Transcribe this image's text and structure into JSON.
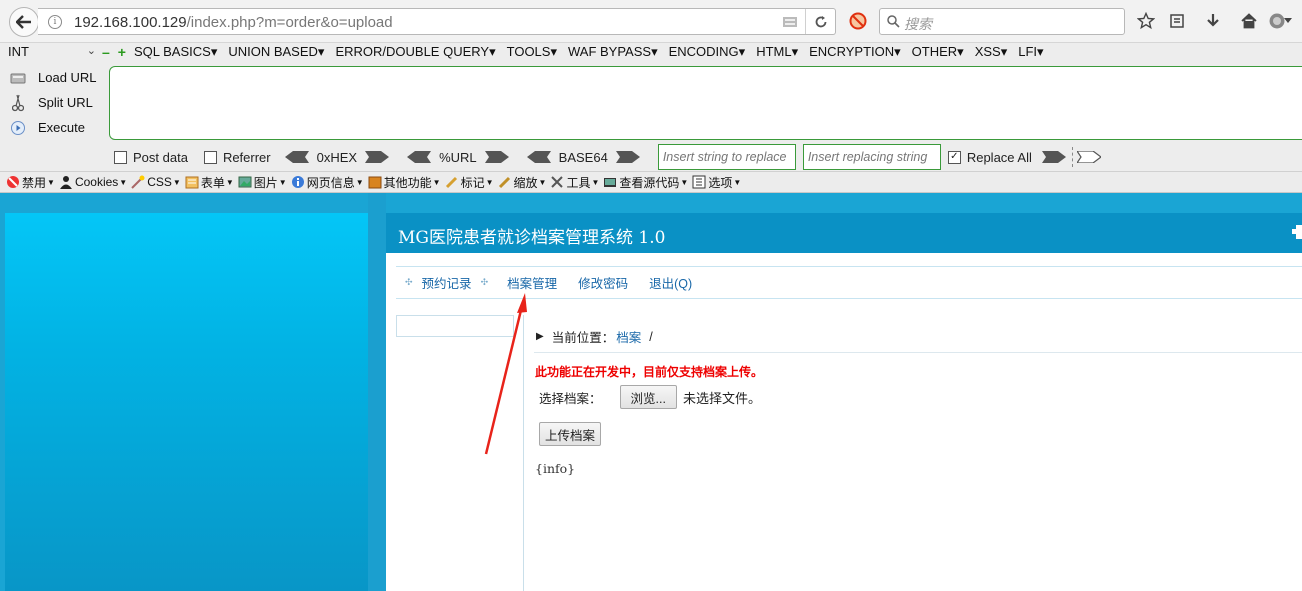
{
  "browser": {
    "url_host": "192.168.100.129",
    "url_path": "/index.php?m=order&o=upload",
    "search_placeholder": "搜索"
  },
  "hackbar": {
    "type_select": "INT",
    "menu": [
      "SQL BASICS",
      "UNION BASED",
      "ERROR/DOUBLE QUERY",
      "TOOLS",
      "WAF BYPASS",
      "ENCODING",
      "HTML",
      "ENCRYPTION",
      "OTHER",
      "XSS",
      "LFI"
    ],
    "actions": {
      "load": "Load URL",
      "split": "Split URL",
      "execute": "Execute"
    },
    "post_data": "Post data",
    "referrer": "Referrer",
    "encodings": [
      "0xHEX",
      "%URL",
      "BASE64"
    ],
    "replace_ph": "Insert string to replace",
    "replacing_ph": "Insert replacing string",
    "replace_all": "Replace All",
    "replace_all_checked": true
  },
  "webdev": {
    "items": [
      "禁用",
      "Cookies",
      "CSS",
      "表单",
      "图片",
      "网页信息",
      "其他功能",
      "标记",
      "缩放",
      "工具",
      "查看源代码",
      "选项"
    ]
  },
  "app": {
    "title": "MG医院患者就诊档案管理系统 1.0",
    "tabs": [
      "预约记录",
      "档案管理",
      "修改密码",
      "退出(Q)"
    ],
    "breadcrumb_label": "当前位置：",
    "breadcrumb_link": "档案",
    "breadcrumb_sep": "/",
    "notice": "此功能正在开发中，目前仅支持档案上传。",
    "file_label": "选择档案：",
    "browse_label": "浏览...",
    "no_file": "未选择文件。",
    "upload_label": "上传档案",
    "info": "{info}"
  }
}
